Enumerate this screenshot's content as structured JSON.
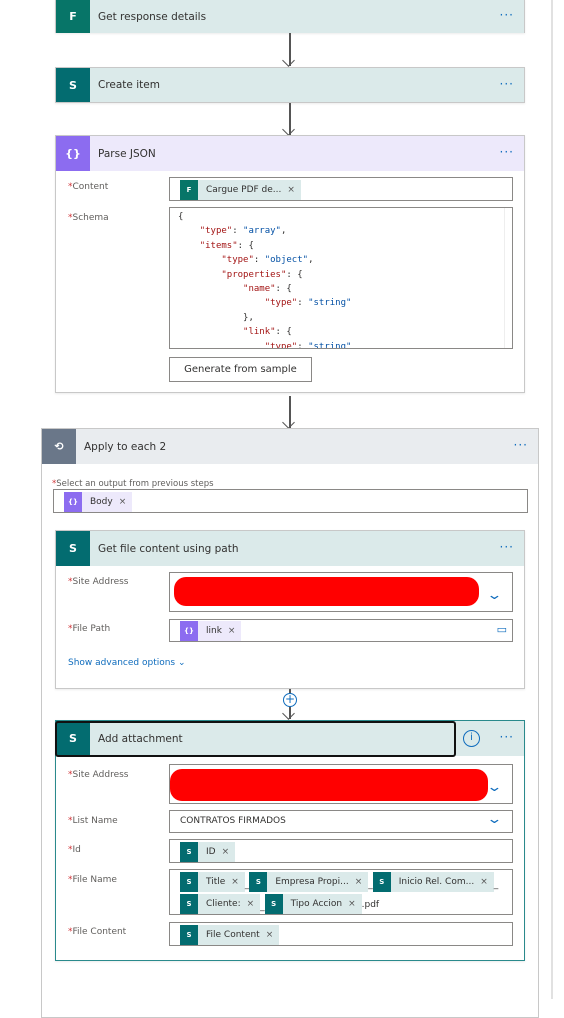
{
  "steps": {
    "get_response": {
      "title": "Get response details"
    },
    "create_item": {
      "title": "Create item"
    },
    "parse_json": {
      "title": "Parse JSON",
      "content_label": "Content",
      "content_token": "Cargue PDF de...",
      "schema_label": "Schema",
      "schema_lines": [
        [
          "{",
          "",
          ""
        ],
        [
          "    ",
          "\"type\"",
          ": ",
          "\"array\"",
          ","
        ],
        [
          "    ",
          "\"items\"",
          ": {"
        ],
        [
          "        ",
          "\"type\"",
          ": ",
          "\"object\"",
          ","
        ],
        [
          "        ",
          "\"properties\"",
          ": {"
        ],
        [
          "            ",
          "\"name\"",
          ": {"
        ],
        [
          "                ",
          "\"type\"",
          ": ",
          "\"string\""
        ],
        [
          "            ",
          "",
          "},"
        ],
        [
          "            ",
          "\"link\"",
          ": {"
        ],
        [
          "                ",
          "\"type\"",
          ": ",
          "\"string\""
        ]
      ],
      "generate_button": "Generate from sample"
    },
    "apply_each": {
      "title": "Apply to each 2",
      "select_label": "Select an output from previous steps",
      "token": "Body"
    },
    "get_file": {
      "title": "Get file content using path",
      "site_label": "Site Address",
      "path_label": "File Path",
      "path_token": "link",
      "advanced": "Show advanced options"
    },
    "add_attachment": {
      "title": "Add attachment",
      "site_label": "Site Address",
      "list_label": "List Name",
      "list_value": "CONTRATOS FIRMADOS",
      "id_label": "Id",
      "id_token": "ID",
      "filename_label": "File Name",
      "filename_tokens": [
        "Title",
        "Empresa Propi...",
        "Inicio Rel. Com...",
        "Cliente:",
        "Tipo Accion"
      ],
      "separator": "_",
      "suffix": ".pdf",
      "content_label": "File Content",
      "content_token": "File Content"
    }
  },
  "required_mark": "*",
  "menu_glyph": "···"
}
